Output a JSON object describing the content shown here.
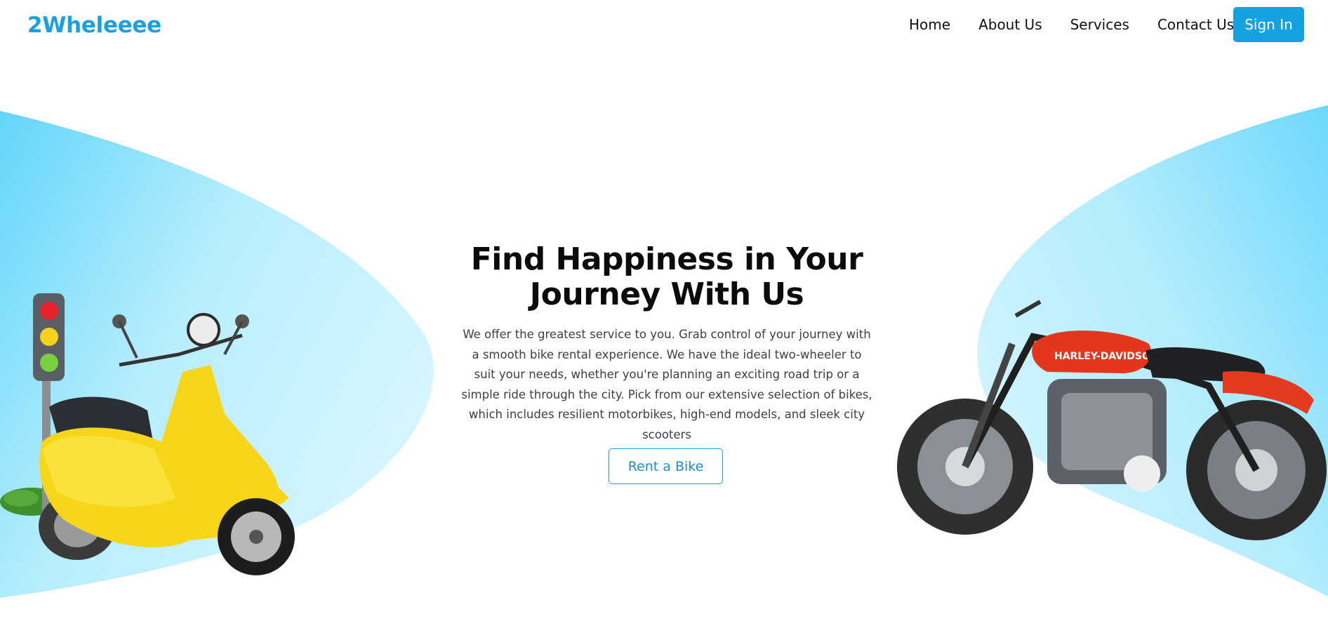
{
  "brand": {
    "name": "2Wheleeee",
    "color": "#1aa0e0"
  },
  "nav": {
    "items": [
      "Home",
      "About Us",
      "Services",
      "Contact Us"
    ],
    "signin_label": "Sign In",
    "accent": "#14a2e3"
  },
  "hero": {
    "title_line1": "Find Happiness in Your",
    "title_line2": "Journey With Us",
    "description": "We offer the greatest service to you. Grab control of your journey with a smooth bike rental experience. We have the ideal two-wheeler to suit your needs, whether you're planning an exciting road trip or a simple ride through the city. Pick from our extensive selection of bikes, which includes resilient motorbikes, high-end models, and sleek city scooters",
    "cta_label": "Rent a Bike"
  },
  "images": {
    "left": "yellow-scooter-with-traffic-light",
    "right": "red-motorcycle",
    "motorcycle_tank_text": "HARLEY-DAVIDSON"
  },
  "colors": {
    "blob_light": "#cdf3fd",
    "blob_mid": "#8fe2fb",
    "blob_dark": "#62d5fa"
  }
}
